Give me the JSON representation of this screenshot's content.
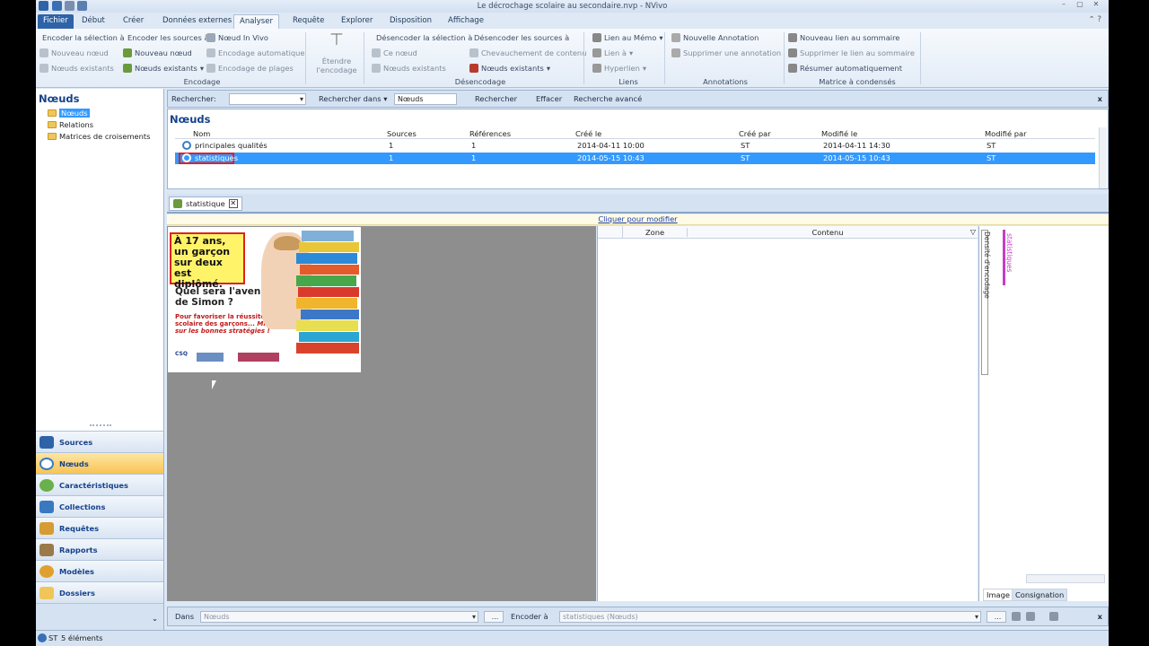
{
  "window": {
    "title": "Le décrochage scolaire au secondaire.nvp - NVivo",
    "controls": [
      "–",
      "▢",
      "✕"
    ]
  },
  "menu": {
    "tabs": [
      "Fichier",
      "Début",
      "Créer",
      "Données externes",
      "Analyser",
      "Requête",
      "Explorer",
      "Disposition",
      "Affichage"
    ]
  },
  "ribbon": {
    "encodage": {
      "label": "Encodage",
      "items": [
        "Encoder la sélection à",
        "Encoder les sources à",
        "Nœud In Vivo",
        "Nouveau nœud",
        "Nouveau nœud",
        "Encodage automatique",
        "Nœuds existants",
        "Nœuds existants",
        "Encodage de plages"
      ]
    },
    "etendre": {
      "line1": "Étendre",
      "line2": "l'encodage"
    },
    "desencodage": {
      "label": "Désencodage",
      "items": [
        "Désencoder la sélection à",
        "Désencoder les sources à",
        "Ce nœud",
        "Chevauchement de contenu",
        "Nœuds existants",
        "Nœuds existants"
      ]
    },
    "liens": {
      "label": "Liens",
      "items": [
        "Lien au Mémo",
        "Lien à",
        "Hyperlien"
      ]
    },
    "annotations": {
      "label": "Annotations",
      "items": [
        "Nouvelle Annotation",
        "Supprimer une annotation"
      ]
    },
    "matrice": {
      "label": "Matrice à condensés",
      "items": [
        "Nouveau lien au sommaire",
        "Supprimer le lien au sommaire",
        "Résumer automatiquement"
      ]
    }
  },
  "left": {
    "title": "Nœuds",
    "tree": [
      "Nœuds",
      "Relations",
      "Matrices de croisements"
    ],
    "nav": [
      "Sources",
      "Nœuds",
      "Caractéristiques",
      "Collections",
      "Requêtes",
      "Rapports",
      "Modèles",
      "Dossiers"
    ]
  },
  "search": {
    "label": "Rechercher:",
    "in_label": "Rechercher dans",
    "in_value": "Nœuds",
    "search_btn": "Rechercher",
    "clear_btn": "Effacer",
    "advanced": "Recherche avancé",
    "close": "x"
  },
  "nodes": {
    "title": "Nœuds",
    "headers": [
      "Nom",
      "Sources",
      "Références",
      "Créé le",
      "Créé par",
      "Modifié le",
      "Modifié par"
    ],
    "rows": [
      {
        "name": "principales qualités",
        "sources": "1",
        "refs": "1",
        "created": "2014-04-11 10:00",
        "by": "ST",
        "modified": "2014-04-11 14:30",
        "mby": "ST"
      },
      {
        "name": "statistiques",
        "sources": "1",
        "refs": "1",
        "created": "2014-05-15 10:43",
        "by": "ST",
        "modified": "2014-05-15 10:43",
        "mby": "ST"
      }
    ]
  },
  "detail": {
    "tab": "statistique",
    "click_to_edit": "Cliquer pour modifier",
    "poster": {
      "headline": "À 17 ans, un garçon sur deux est diplômé.",
      "question": "Quel sera l'avenir de Simon ?",
      "sub1": "Pour favoriser la réussite scolaire des garçons...",
      "sub2": "Misons sur les bonnes stratégies !",
      "logo": "CSQ"
    },
    "columns": [
      "Zone",
      "Contenu"
    ],
    "stripe_vertical": "Densité d'encodage",
    "stripe_label": "statistiques",
    "tabs": [
      "Image",
      "Consignation"
    ]
  },
  "bottom": {
    "in_label": "Dans",
    "in_value": "Nœuds",
    "encode_label": "Encoder à",
    "encode_value": "statistiques (Nœuds)",
    "dots": "...",
    "close": "x"
  },
  "status": {
    "user": "ST",
    "count": "5 éléments"
  },
  "colors": {
    "accent": "#2e63a8",
    "selection": "#3399ff",
    "nav_selected": "#f9c354"
  }
}
